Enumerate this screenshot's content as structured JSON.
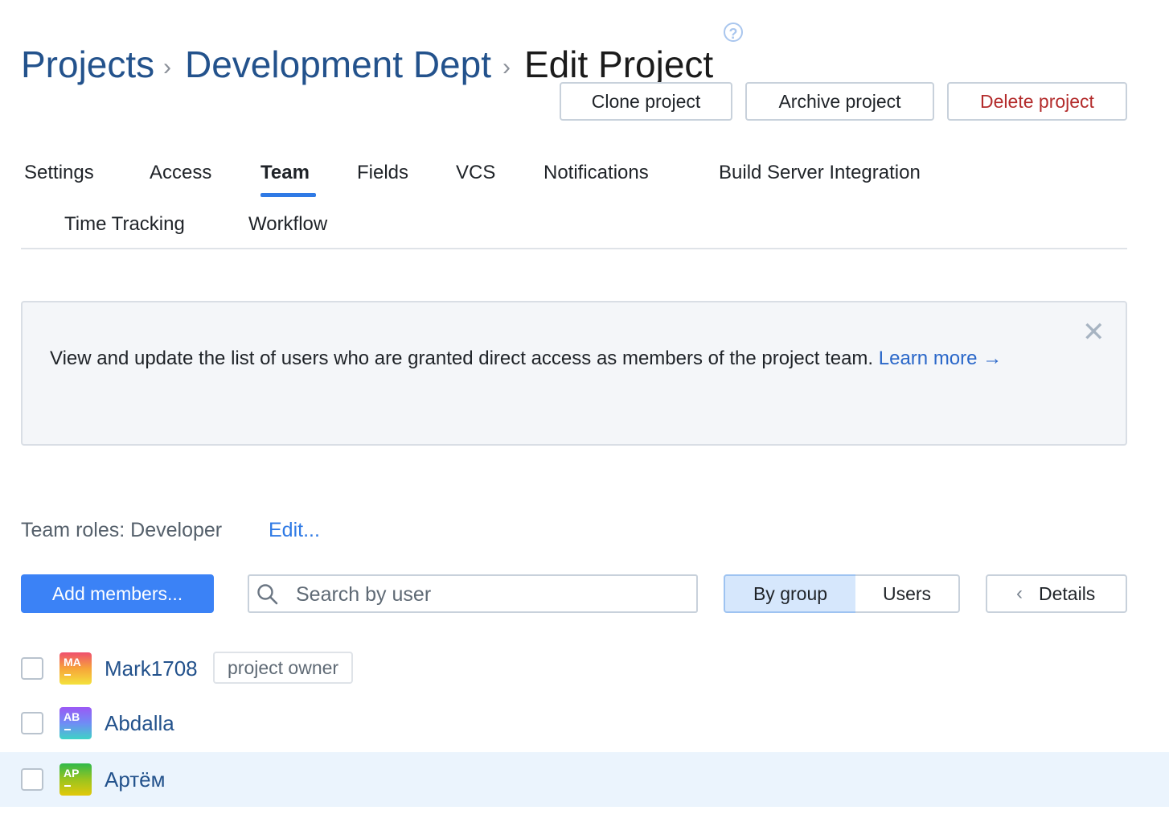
{
  "breadcrumb": {
    "items": [
      "Projects",
      "Development Dept"
    ],
    "current": "Edit Project",
    "separator": "›"
  },
  "help_icon": "question-circle-icon",
  "actions": {
    "clone": "Clone project",
    "archive": "Archive project",
    "delete": "Delete project"
  },
  "tabs": [
    {
      "label": "Settings"
    },
    {
      "label": "Access"
    },
    {
      "label": "Team",
      "active": true
    },
    {
      "label": "Fields"
    },
    {
      "label": "VCS"
    },
    {
      "label": "Notifications"
    },
    {
      "label": "Build Server Integration"
    },
    {
      "label": "Time Tracking"
    },
    {
      "label": "Workflow"
    }
  ],
  "banner": {
    "text": "View and update the list of users who are granted direct access as members of the project team.",
    "link": "Learn more →",
    "close_icon": "close-icon"
  },
  "team_roles": {
    "label": "Team roles: Developer",
    "edit": "Edit..."
  },
  "toolbar": {
    "add_members": "Add members...",
    "search_placeholder": "Search by user",
    "by_group": "By group",
    "users": "Users",
    "details": "Details",
    "details_chevron": "‹"
  },
  "members": [
    {
      "initials": "MA",
      "name": "Mark1708",
      "tag": "project owner",
      "colors": [
        "#ef4f6f",
        "#f7a43a",
        "#f4e23c"
      ]
    },
    {
      "initials": "AB",
      "name": "Abdalla",
      "tag": "",
      "colors": [
        "#9b59f5",
        "#6f8cf5",
        "#3ed3c6"
      ]
    },
    {
      "initials": "AP",
      "name": "Артём",
      "tag": "",
      "colors": [
        "#2fb94b",
        "#9ac41f",
        "#e2c80a"
      ],
      "highlighted": true
    }
  ],
  "colors": {
    "link": "#23528c",
    "accent": "#3b82f6",
    "danger": "#b32b2b",
    "highlight_row": "#ebf4fd"
  }
}
